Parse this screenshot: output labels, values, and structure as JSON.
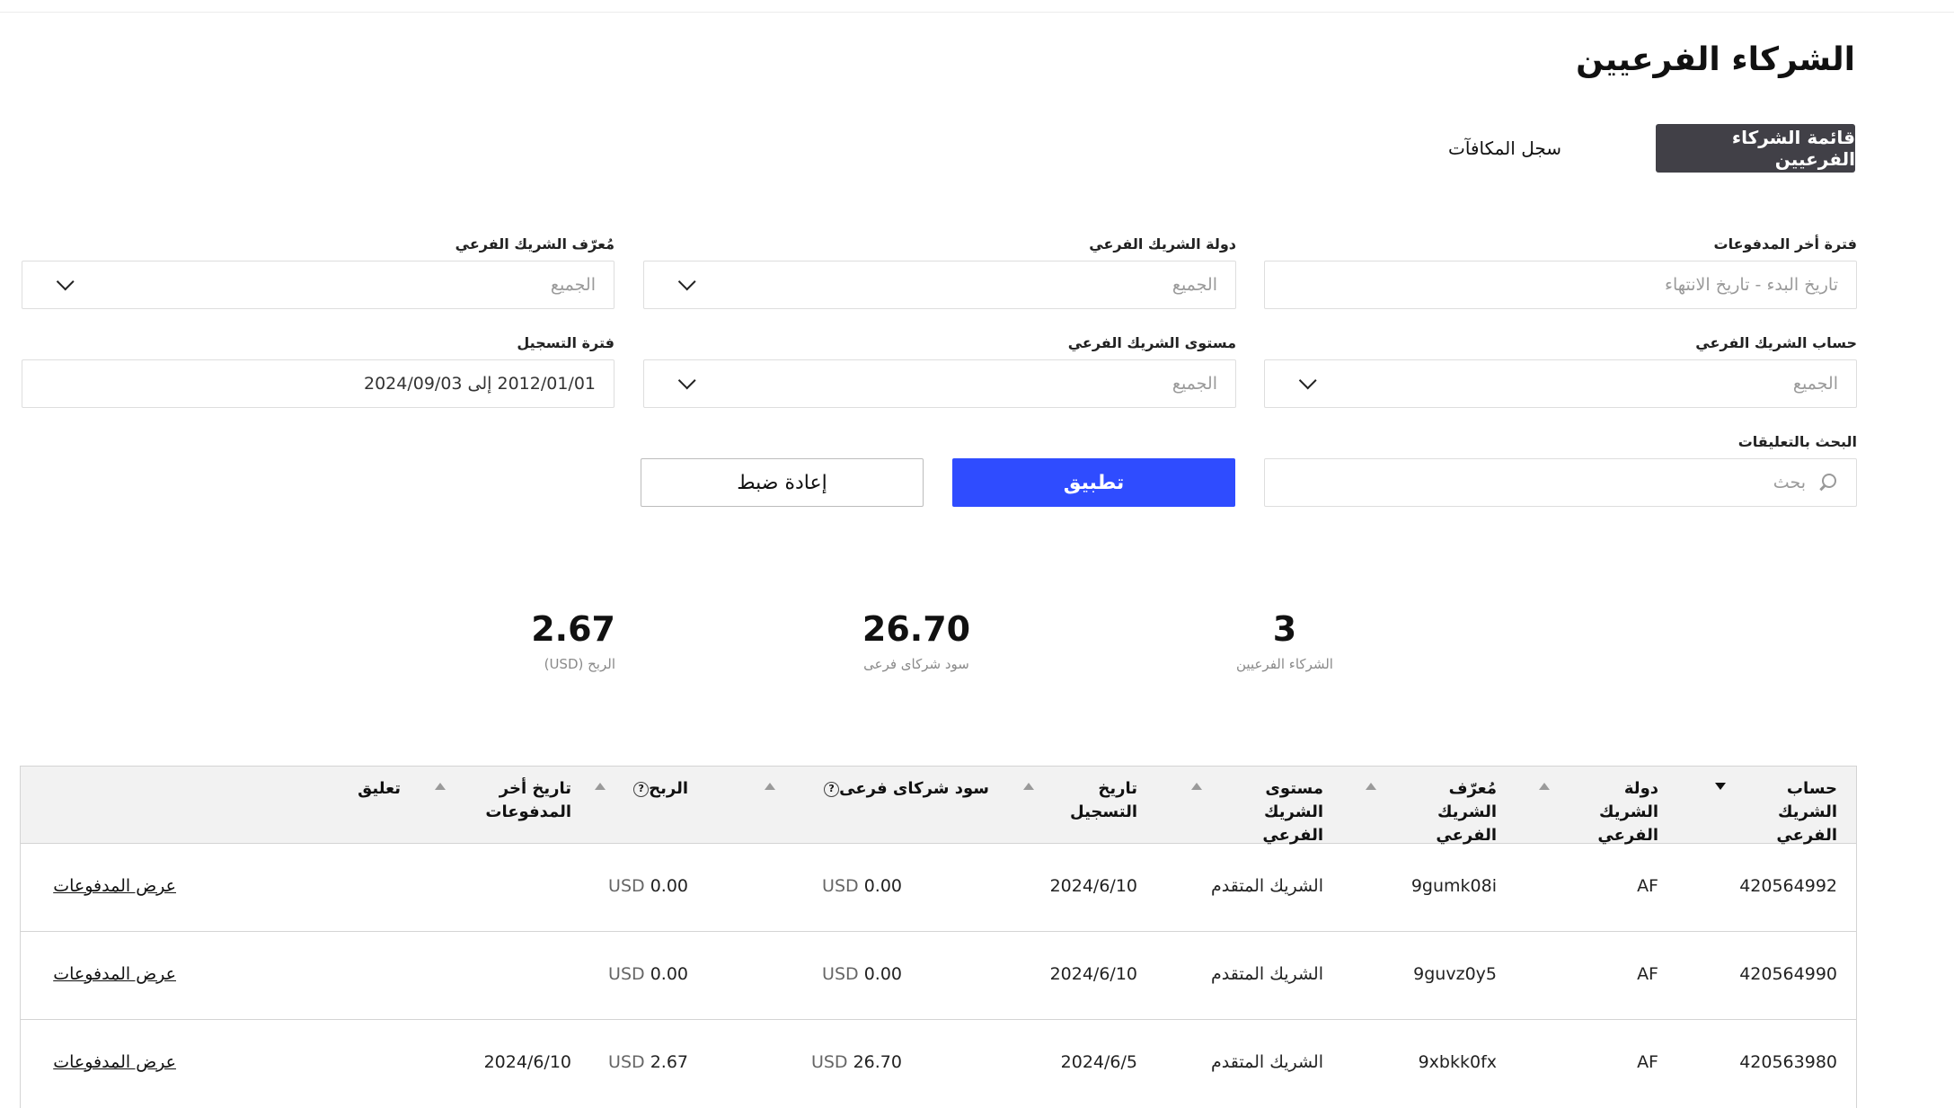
{
  "page": {
    "title": "الشركاء الفرعيين"
  },
  "tabs": {
    "active": "قائمة الشركاء الفرعيين",
    "other": "سجل المكافآت"
  },
  "filters": {
    "payment_period": {
      "label": "فترة أخر المدفوعات",
      "placeholder": "تاريخ البدء - تاريخ الانتهاء"
    },
    "country": {
      "label": "دولة الشريك الفرعي",
      "value": "الجميع"
    },
    "sub_id": {
      "label": "مُعرّف الشريك الفرعي",
      "value": "الجميع"
    },
    "account": {
      "label": "حساب الشريك الفرعي",
      "value": "الجميع"
    },
    "level": {
      "label": "مستوى الشريك الفرعي",
      "value": "الجميع"
    },
    "reg_period": {
      "label": "فترة التسجيل",
      "value": "2012/01/01 إلى 2024/09/03"
    },
    "comment_search": {
      "label": "البحث بالتعليقات",
      "placeholder": "بحث"
    },
    "apply": "تطبيق",
    "reset": "إعادة ضبط"
  },
  "stats": {
    "partners": {
      "value": "3",
      "label": "الشركاء الفرعيين"
    },
    "volume": {
      "value": "26.70",
      "label": "سود شركاى فرعى"
    },
    "profit": {
      "value": "2.67",
      "label": "الربح (USD)"
    }
  },
  "table": {
    "headers": {
      "account": "حساب الشريك الفرعي",
      "country": "دولة الشريك الفرعي",
      "sub_id": "مُعرّف الشريك الفرعي",
      "level": "مستوى الشريك الفرعي",
      "reg_date": "تاريخ التسجيل",
      "volume": "سود شركاى فرعى",
      "profit": "الربح",
      "last_payment": "تاريخ أخر المدفوعات",
      "comment": "تعليق"
    },
    "rows": [
      {
        "account": "420564992",
        "country": "AF",
        "sub_id": "9gumk08i",
        "level": "الشريك المتقدم",
        "reg_date": "2024/6/10",
        "volume": "0.00",
        "volume_cur": "USD",
        "profit": "0.00",
        "profit_cur": "USD",
        "last_payment": "",
        "action": "عرض المدفوعات"
      },
      {
        "account": "420564990",
        "country": "AF",
        "sub_id": "9guvz0y5",
        "level": "الشريك المتقدم",
        "reg_date": "2024/6/10",
        "volume": "0.00",
        "volume_cur": "USD",
        "profit": "0.00",
        "profit_cur": "USD",
        "last_payment": "",
        "action": "عرض المدفوعات"
      },
      {
        "account": "420563980",
        "country": "AF",
        "sub_id": "9xbkk0fx",
        "level": "الشريك المتقدم",
        "reg_date": "2024/6/5",
        "volume": "26.70",
        "volume_cur": "USD",
        "profit": "2.67",
        "profit_cur": "USD",
        "last_payment": "2024/6/10",
        "action": "عرض المدفوعات"
      }
    ]
  }
}
